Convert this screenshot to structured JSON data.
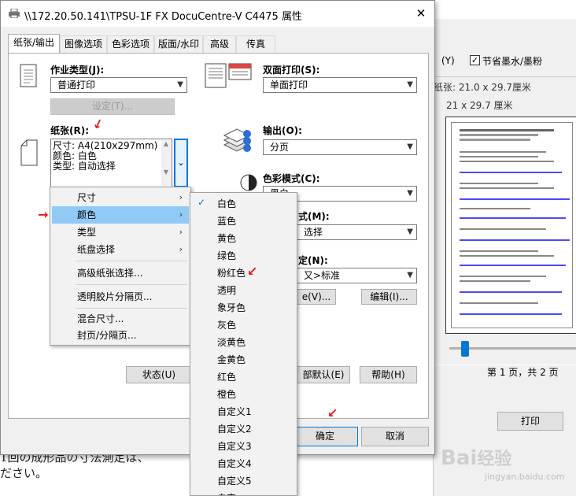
{
  "dialog": {
    "title": "\\\\172.20.50.141\\TPSU-1F FX DocuCentre-V C4475 属性",
    "close": "✕"
  },
  "tabs": [
    "纸张/输出",
    "图像选项",
    "色彩选项",
    "版面/水印",
    "高级",
    "传真"
  ],
  "job_type": {
    "label": "作业类型(J):",
    "value": "普通打印",
    "settings_button": "设定(T)..."
  },
  "duplex": {
    "label": "双面打印(S):",
    "value": "单面打印"
  },
  "paper": {
    "label": "纸张(R):",
    "summary": [
      "尺寸: A4(210x297mm)",
      "颜色: 白色",
      "类型: 自动选择"
    ]
  },
  "output": {
    "label": "输出(O):",
    "value": "分页"
  },
  "color_mode": {
    "label": "色彩模式(C):",
    "value": "黑白"
  },
  "partial_right": {
    "label1": "式(M):",
    "value1": "选择",
    "label2": "定(N):",
    "value2": "又>标准",
    "btn_left": "e(V)...",
    "btn_edit": "编辑(I)..."
  },
  "bottom_buttons": {
    "status": "状态(U)",
    "defaults": "部默认(E)",
    "help": "帮助(H)",
    "ok": "确定",
    "cancel": "取消"
  },
  "context_menu": [
    {
      "label": "尺寸",
      "submenu": true
    },
    {
      "label": "颜色",
      "submenu": true,
      "highlighted": true
    },
    {
      "label": "类型",
      "submenu": true
    },
    {
      "label": "纸盘选择",
      "submenu": true
    },
    {
      "label": "高级纸张选择...",
      "submenu": false
    },
    {
      "label": "透明胶片分隔页...",
      "submenu": false
    },
    {
      "label": "混合尺寸...",
      "submenu": false
    },
    {
      "label": "封页/分隔页...",
      "submenu": false
    }
  ],
  "color_submenu": [
    "白色",
    "蓝色",
    "黄色",
    "绿色",
    "粉红色",
    "透明",
    "象牙色",
    "灰色",
    "淡黄色",
    "金黄色",
    "红色",
    "橙色",
    "自定义1",
    "自定义2",
    "自定义3",
    "自定义4",
    "自定义5",
    "自定..."
  ],
  "color_submenu_checked": "白色",
  "bg_window": {
    "check1": "(Y)",
    "check2": "节省墨水/墨粉",
    "line1": "纸张:  21.0 x 29.7厘米",
    "line2": "21 x 29.7 厘米",
    "page_info": "第 1 页，共 2 页",
    "print_button": "打印"
  },
  "bg_doc_text": [
    "1回の成形品の寸法測定は、",
    "ださい。"
  ],
  "watermark": {
    "logo": "Bai",
    "logo2": "经验",
    "url": "jingyan.baidu.com"
  },
  "colors": {
    "accent": "#0078d7",
    "menu_highlight": "#91c9f7",
    "red_arrow": "#e02020"
  }
}
